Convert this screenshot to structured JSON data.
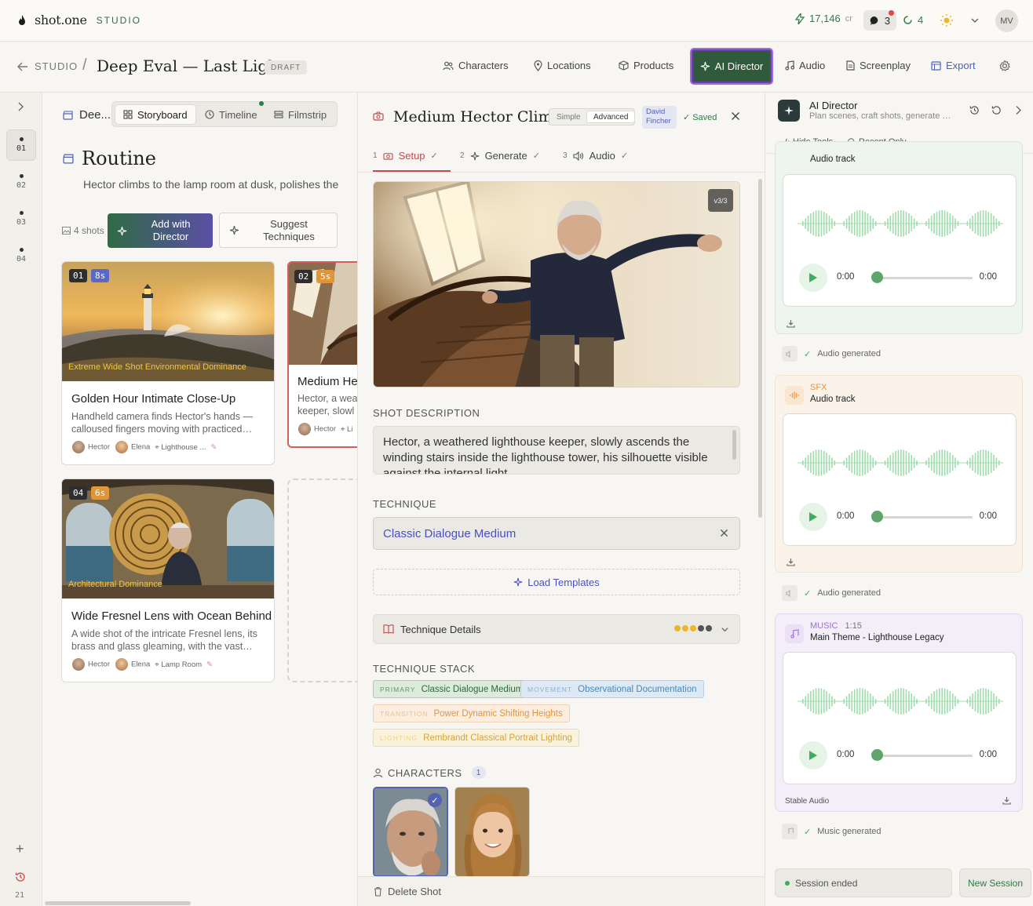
{
  "brand": {
    "name": "shot.one",
    "suffix": "STUDIO"
  },
  "topbar": {
    "credits": "17,146",
    "credits_unit": "cr",
    "messages": "3",
    "jobs": "4",
    "avatar": "MV"
  },
  "project": {
    "back_label": "STUDIO",
    "separator": "/",
    "title": "Deep Eval — Last Light",
    "status": "DRAFT"
  },
  "nav": {
    "characters": "Characters",
    "locations": "Locations",
    "products": "Products",
    "director": "AI Director",
    "audio": "Audio",
    "screenplay": "Screenplay",
    "export": "Export"
  },
  "rail": {
    "items": [
      "01",
      "02",
      "03",
      "04"
    ],
    "history_count": "21"
  },
  "board": {
    "title": "Dee...",
    "tabs": {
      "storyboard": "Storyboard",
      "timeline": "Timeline",
      "filmstrip": "Filmstrip"
    },
    "scene_title": "Routine",
    "scene_desc": "Hector climbs to the lamp room at dusk, polishes the",
    "shots_count": "4 shots",
    "add_director": "Add with Director",
    "suggest": "Suggest Techniques",
    "cards": [
      {
        "num": "01",
        "dur": "8s",
        "overlay": "Extreme Wide Shot Environmental Dominance",
        "title": "Golden Hour Intimate Close-Up",
        "desc": "Handheld camera finds Hector's hands — calloused fingers moving with practiced…",
        "char1": "Hector",
        "char2": "Elena",
        "loc": "Lighthouse ..."
      },
      {
        "num": "02",
        "dur": "5s",
        "title": "Medium He",
        "desc": "Hector, a wea keeper, slowl",
        "char1": "Hector",
        "loc": "Li"
      },
      {
        "num": "04",
        "dur": "6s",
        "overlay": "Architectural Dominance",
        "title": "Wide Fresnel Lens with Ocean Behind",
        "desc": "A wide shot of the intricate Fresnel lens, its brass and glass gleaming, with the vast…",
        "char1": "Hector",
        "char2": "Elena",
        "loc": "Lamp Room"
      }
    ]
  },
  "detail": {
    "title": "Medium Hector Climbing",
    "mode_simple": "Simple",
    "mode_advanced": "Advanced",
    "director_tag": "David Fincher",
    "saved": "Saved",
    "steps": [
      {
        "n": "1",
        "label": "Setup"
      },
      {
        "n": "2",
        "label": "Generate"
      },
      {
        "n": "3",
        "label": "Audio"
      }
    ],
    "version": "v3/3",
    "shot_desc_label": "SHOT DESCRIPTION",
    "shot_desc": "Hector, a weathered lighthouse keeper, slowly ascends the winding stairs inside the lighthouse tower, his silhouette visible against the internal light",
    "technique_label": "TECHNIQUE",
    "technique": "Classic Dialogue Medium",
    "load_templates": "Load Templates",
    "technique_details": "Technique Details",
    "technique_rating": 3,
    "stack_label": "TECHNIQUE STACK",
    "stack": [
      {
        "kind": "PRIMARY",
        "value": "Classic Dialogue Medium"
      },
      {
        "kind": "MOVEMENT",
        "value": "Observational Documentation"
      },
      {
        "kind": "TRANSITION",
        "value": "Power Dynamic Shifting Heights"
      },
      {
        "kind": "LIGHTING",
        "value": "Rembrandt Classical Portrait Lighting"
      }
    ],
    "characters_label": "CHARACTERS",
    "characters_count": "1",
    "delete": "Delete Shot"
  },
  "ai": {
    "title": "AI Director",
    "subtitle": "Plan scenes, craft shots, generate visuals",
    "hide_tools": "Hide Tools",
    "recent_only": "Recent Only",
    "tracks": [
      {
        "kind": "",
        "name": "Audio track",
        "t0": "0:00",
        "t1": "0:00"
      },
      {
        "kind": "SFX",
        "name": "Audio track",
        "t0": "0:00",
        "t1": "0:00"
      },
      {
        "kind": "MUSIC",
        "duration": "1:15",
        "name": "Main Theme - Lighthouse Legacy",
        "t0": "0:00",
        "t1": "0:00",
        "provider": "Stable Audio"
      }
    ],
    "status_audio": "Audio generated",
    "status_music": "Music generated",
    "session_ended": "Session ended",
    "new_session": "New Session"
  },
  "colors": {
    "accent_green": "#2f6b45",
    "accent_purple": "#5a4fa5",
    "link_blue": "#4a4fc4",
    "active_red": "#c14a4a"
  }
}
